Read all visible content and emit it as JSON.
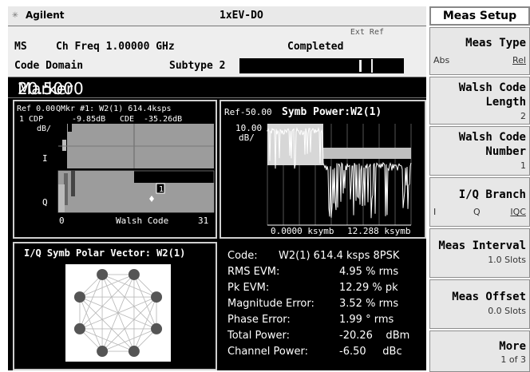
{
  "titlebar": {
    "brand": "Agilent",
    "mode": "1xEV-DO"
  },
  "status": {
    "trigger": "Ext Ref",
    "ms": "MS",
    "ch_freq": "Ch Freq  1.00000 GHz",
    "completed": "Completed",
    "measurement": "Code Domain",
    "subtype": "Subtype 2"
  },
  "marker": {
    "label": "Marker",
    "value": "20.5000"
  },
  "cdp": {
    "ref": "Ref 0.00",
    "mkr": "QMkr #1: W2(1) 614.4ksps",
    "cdp": "1 CDP",
    "cdp_val": "-9.85dB",
    "cde": "CDE",
    "cde_val": "-35.26dB",
    "scale": "dB/",
    "i_label": "I",
    "q_label": "Q",
    "x_start": "0",
    "x_mid": "Walsh Code",
    "x_end": "31",
    "marker_num": "1"
  },
  "symb": {
    "ref": "Ref-50.00",
    "title": "Symb Power:W2(1)",
    "scale1": "10.00",
    "scale2": "dB/",
    "x_start": "0.0000  ksymb",
    "x_end": "12.288  ksymb"
  },
  "polar": {
    "title": "I/Q Symb Polar Vector: W2(1)"
  },
  "results": {
    "rows": [
      {
        "label": "Code:",
        "value": "W2(1) 614.4 ksps 8PSK"
      },
      {
        "label": "RMS EVM:",
        "value": "4.95 % rms"
      },
      {
        "label": "Pk EVM:",
        "value": "12.29 % pk"
      },
      {
        "label": "Magnitude Error:",
        "value": "3.52 % rms"
      },
      {
        "label": "Phase Error:",
        "value": "1.99 ° rms"
      },
      {
        "label": "Total Power:",
        "value": "-20.26    dBm"
      },
      {
        "label": "Channel Power:",
        "value": "-6.50     dBc"
      }
    ]
  },
  "softkeys": {
    "title": "Meas Setup",
    "meas_type": {
      "label": "Meas Type",
      "opt1": "Abs",
      "opt2": "Rel"
    },
    "walsh_len": {
      "l1": "Walsh Code",
      "l2": "Length",
      "value": "2"
    },
    "walsh_num": {
      "l1": "Walsh Code",
      "l2": "Number",
      "value": "1"
    },
    "iq_branch": {
      "label": "I/Q Branch",
      "opt1": "I",
      "opt2": "Q",
      "opt3": "IQC"
    },
    "meas_interval": {
      "label": "Meas Interval",
      "value": "1.0 Slots"
    },
    "meas_offset": {
      "label": "Meas Offset",
      "value": "0.0 Slots"
    },
    "more": {
      "label": "More",
      "value": "1 of 3"
    }
  },
  "colors": {
    "screen_bg": "#000000",
    "trace": "#ffffff",
    "bars": "#9c9c9c"
  }
}
